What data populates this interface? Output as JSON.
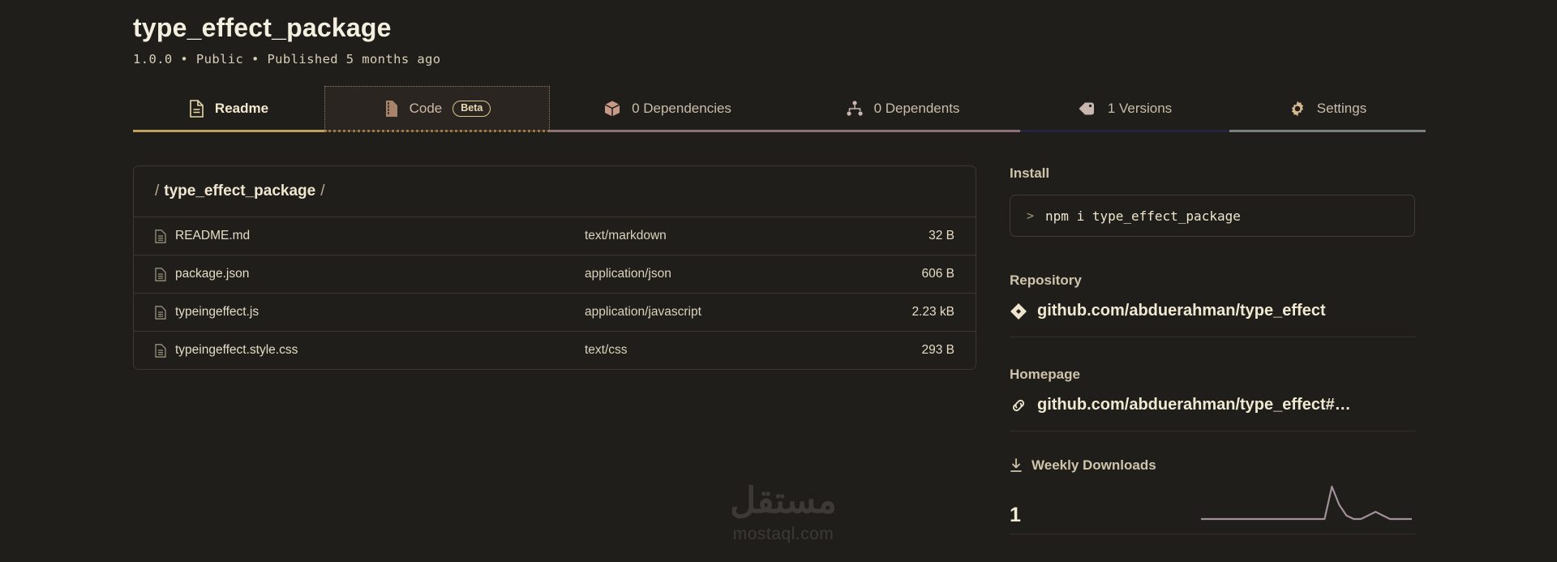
{
  "header": {
    "title": "type_effect_package",
    "meta": "1.0.0 • Public • Published 5 months ago"
  },
  "tabs": [
    {
      "id": "readme",
      "label": "Readme",
      "icon": "document-icon",
      "active": true,
      "badge": null
    },
    {
      "id": "code",
      "label": "Code",
      "icon": "code-file-icon",
      "active": false,
      "badge": "Beta"
    },
    {
      "id": "dependencies",
      "label": "0 Dependencies",
      "icon": "package-box-icon",
      "active": false,
      "badge": null
    },
    {
      "id": "dependents",
      "label": "0 Dependents",
      "icon": "dependents-icon",
      "active": false,
      "badge": null
    },
    {
      "id": "versions",
      "label": "1 Versions",
      "icon": "tag-icon",
      "active": false,
      "badge": null
    },
    {
      "id": "settings",
      "label": "Settings",
      "icon": "gear-icon",
      "active": false,
      "badge": null
    }
  ],
  "files": {
    "breadcrumb_prefix": "/",
    "breadcrumb_name": "type_effect_package",
    "breadcrumb_suffix": "/",
    "rows": [
      {
        "name": "README.md",
        "type": "text/markdown",
        "size": "32 B"
      },
      {
        "name": "package.json",
        "type": "application/json",
        "size": "606 B"
      },
      {
        "name": "typeingeffect.js",
        "type": "application/javascript",
        "size": "2.23 kB"
      },
      {
        "name": "typeingeffect.style.css",
        "type": "text/css",
        "size": "293 B"
      }
    ]
  },
  "sidebar": {
    "install_title": "Install",
    "install_command": "npm i type_effect_package",
    "install_prompt": ">",
    "repository_title": "Repository",
    "repository_link": "github.com/abduerahman/type_effect",
    "homepage_title": "Homepage",
    "homepage_link": "github.com/abduerahman/type_effect#…",
    "downloads_title": "Weekly Downloads",
    "downloads_count": "1"
  },
  "watermark": {
    "arabic": "مستقل",
    "latin": "mostaql.com"
  },
  "chart_data": {
    "type": "line",
    "title": "Weekly Downloads",
    "x": [
      0,
      1,
      2,
      3,
      4,
      5,
      6,
      7,
      8,
      9,
      10,
      11,
      12,
      13,
      14,
      15,
      16,
      17,
      18,
      19,
      20,
      21,
      22,
      23,
      24,
      25,
      26,
      27,
      28,
      29
    ],
    "values": [
      0,
      0,
      0,
      0,
      0,
      0,
      0,
      0,
      0,
      0,
      0,
      0,
      0,
      0,
      0,
      0,
      0,
      0,
      9,
      4,
      1,
      0,
      0,
      1,
      2,
      1,
      0,
      0,
      0,
      0
    ],
    "ylabel": "",
    "xlabel": "",
    "grid": false,
    "line_color": "#a18f9a"
  },
  "colors": {
    "background": "#1f1e1b",
    "accent": "#bda15c",
    "text": "#f0e6cf",
    "muted": "#b9ac93",
    "border": "#3c372f",
    "sparkline": "#a18f9a"
  }
}
